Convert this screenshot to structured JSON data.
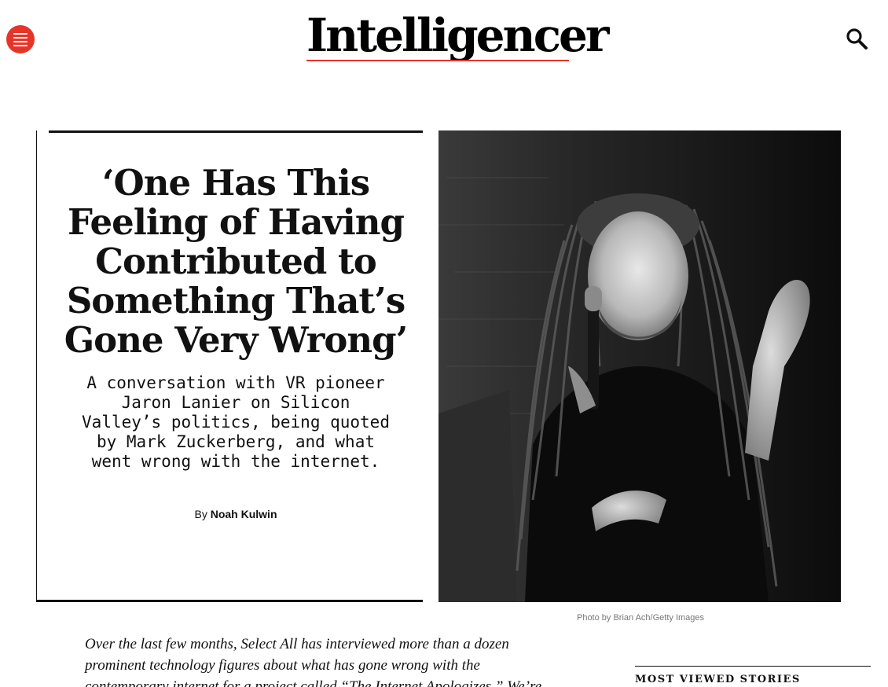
{
  "header": {
    "logo_text": "Intelligencer",
    "icons": {
      "menu": "hamburger-menu-icon",
      "search": "search-icon"
    },
    "accent_color": "#e5352b"
  },
  "article": {
    "headline": "‘One Has This Feeling of Having Contributed to Something That’s Gone Very Wrong’",
    "dek": "A conversation with VR pioneer Jaron Lanier on Silicon Valley’s politics, being quoted by Mark Zuckerberg, and what went wrong with the internet.",
    "byline_prefix": "By",
    "author": "Noah Kulwin",
    "photo_credit": "Photo by Brian Ach/Getty Images",
    "lede": "Over the last few months, Select All has interviewed more than a dozen prominent technology figures about what has gone wrong with the contemporary internet for a project called “The Internet Apologizes.” We’re"
  },
  "sidebar": {
    "most_viewed_title": "MOST VIEWED STORIES"
  }
}
